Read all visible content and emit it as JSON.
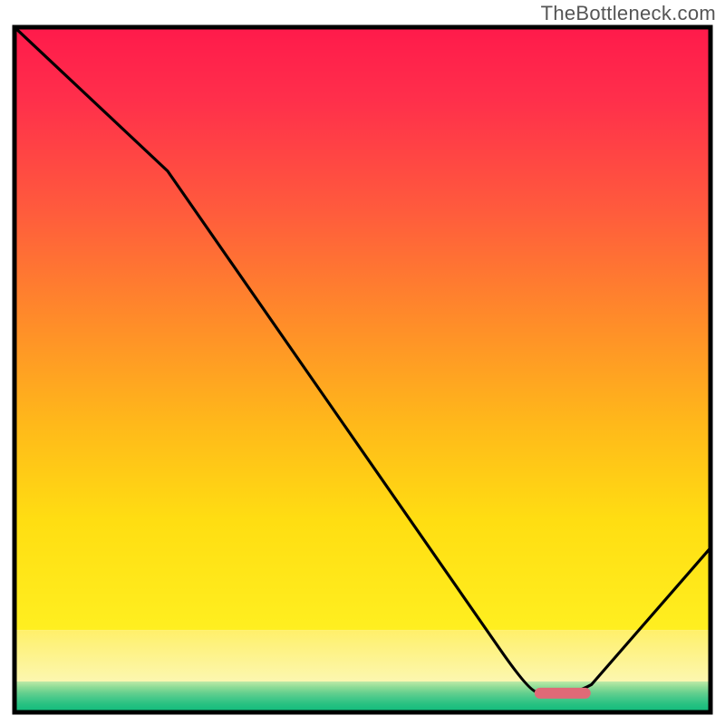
{
  "watermark": "TheBottleneck.com",
  "chart_data": {
    "type": "line",
    "title": "",
    "xlabel": "",
    "ylabel": "",
    "xlim": [
      0,
      100
    ],
    "ylim": [
      0,
      100
    ],
    "grid": false,
    "legend": false,
    "curve": {
      "comment": "Values are visual percentages; 0=bottom/left, 100=top/right of plot area. Estimated from gradient and curve.",
      "x": [
        0,
        22,
        74,
        81,
        100
      ],
      "y": [
        100,
        79,
        3,
        3,
        24
      ]
    },
    "marker": {
      "comment": "Short red segment near the minimum of the curve",
      "x_start": 75.5,
      "x_end": 82,
      "y": 2.8,
      "color": "#e06a77"
    },
    "bands": {
      "comment": "Stacked horizontal bands approximating the red→yellow→green vertical gradient background, percent heights from bottom",
      "green_top_pct": 4.5,
      "yellow_top_pct": 12
    },
    "frame": {
      "stroke": "#000000",
      "width": 5
    }
  }
}
